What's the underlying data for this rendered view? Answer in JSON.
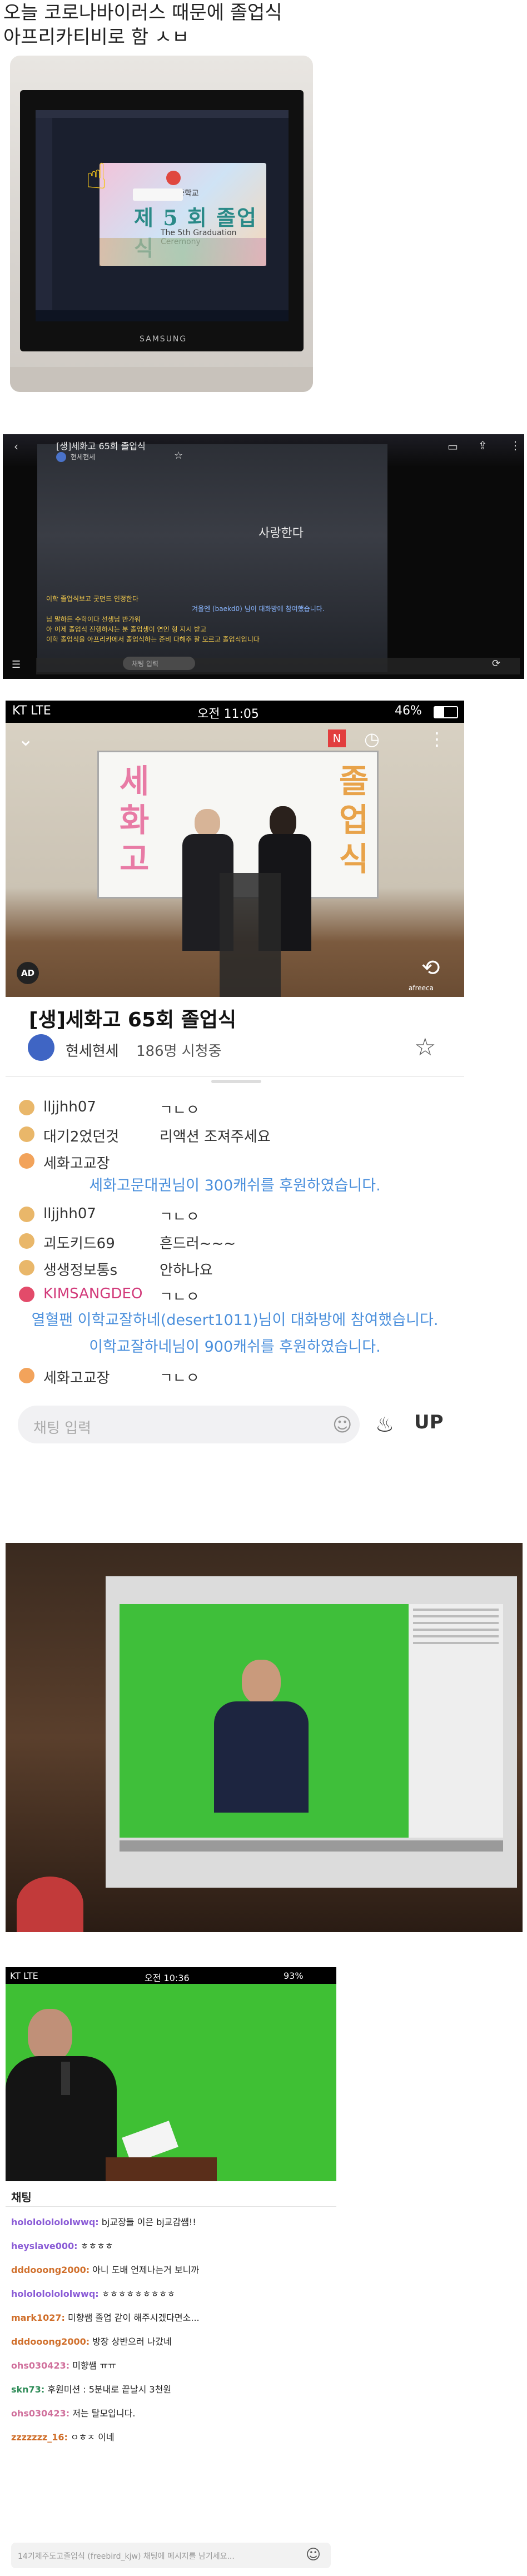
{
  "caption": {
    "line1": "오늘 코로나바이러스 때문에 졸업식",
    "line2": "아프리카티비로 함 ㅅㅂ"
  },
  "photo1": {
    "school_small": "중학교",
    "slide_title": "제 5 회 졸업식",
    "slide_sub": "The 5th Graduation Ceremony",
    "monitor_brand": "SAMSUNG"
  },
  "player2": {
    "title": "[생]세화고 65회 졸업식",
    "channel": "현세현세",
    "overlay_text": "사랑한다",
    "chat": [
      "이학 졸업식보고 굿던드 인정한다",
      "겨울엔 (baekd0) 님이 대화방에 참여했습니다.",
      "님 말하든 수학이다 선생님 반가워",
      "아 이제 졸업식 진행하시는 분 졸업생이 연인 형 지시 받고",
      "이학 졸업식을 아프리카에서 졸업식하는 준비 다해주 잘 모르고 졸업식입니다"
    ],
    "input_placeholder": "채팅 입력"
  },
  "phone3": {
    "carrier": "KT LTE",
    "time": "오전 11:05",
    "battery": "46%",
    "board_chars_left": [
      "세",
      "화",
      "고"
    ],
    "board_chars_right": [
      "졸",
      "업",
      "식"
    ],
    "afreeca_tag": "afreeca",
    "ad_badge": "AD",
    "title": "[생]세화고 65회 졸업식",
    "channel": "현세현세",
    "viewers": "186명 시청중",
    "chat": [
      {
        "type": "msg",
        "user": "lljjhh07",
        "text": "ㄱㄴㅇ"
      },
      {
        "type": "msg",
        "user": "대기2었던것",
        "text": "리액션 조져주세요"
      },
      {
        "type": "msg",
        "user": "세화고교장",
        "text": ""
      },
      {
        "type": "donate",
        "text": "세화고문대권님이 300캐쉬를 후원하였습니다."
      },
      {
        "type": "msg",
        "user": "lljjhh07",
        "text": "ㄱㄴㅇ"
      },
      {
        "type": "msg",
        "user": "괴도키드69",
        "text": "흔드러~~~"
      },
      {
        "type": "msg",
        "user": "생생정보통s",
        "text": "안하나요"
      },
      {
        "type": "msg",
        "user": "KIMSANGDEO",
        "text": "ㄱㄴㅇ"
      },
      {
        "type": "donate",
        "text": "열혈팬 이학교잘하네(desert1011)님이 대화방에 참여했습니다."
      },
      {
        "type": "donate",
        "text": "이학교잘하네님이 900캐쉬를 후원하였습니다."
      },
      {
        "type": "msg",
        "user": "세화고교장",
        "text": "ㄱㄴㅇ"
      }
    ],
    "input_placeholder": "채팅 입력",
    "up_label": "UP"
  },
  "phone5": {
    "carrier": "KT LTE",
    "time": "오전 10:36",
    "battery": "93%",
    "chat_header": "채팅",
    "chat": [
      {
        "user": "hololololololwwq:",
        "text": "bj교장들 이은 bj교감쌤!!",
        "color": "#8a5bd6"
      },
      {
        "user": "heyslave000:",
        "text": "ㅎㅎㅎㅎ",
        "color": "#8a5bd6"
      },
      {
        "user": "dddooong2000:",
        "text": "아니 도배 언제나는거 보니까",
        "color": "#d06f2b"
      },
      {
        "user": "hololololololwwq:",
        "text": "ㅎㅎㅎㅎㅎㅎㅎㅎㅎ",
        "color": "#8a5bd6"
      },
      {
        "user": "mark1027:",
        "text": "미향쌤 졸업 같이 해주시겠다면소...",
        "color": "#d06f2b"
      },
      {
        "user": "dddooong2000:",
        "text": "방장 상반으러 나갔네",
        "color": "#d06f2b"
      },
      {
        "user": "ohs030423:",
        "text": "미향쌤 ㅠㅠ",
        "color": "#d06f9b"
      },
      {
        "user": "skn73:",
        "text": "후원미션 : 5분내로 끝날시 3천원",
        "color": "#2e8b57"
      },
      {
        "user": "ohs030423:",
        "text": "저는 탈모입니다.",
        "color": "#d06f9b"
      },
      {
        "user": "zzzzzzz_16:",
        "text": "ㅇㅎㅈ 이네",
        "color": "#d06f2b"
      }
    ],
    "input_placeholder": "14기제주도고졸업식 (freebird_kjw) 채팅에 메시지를 남기세요..."
  }
}
